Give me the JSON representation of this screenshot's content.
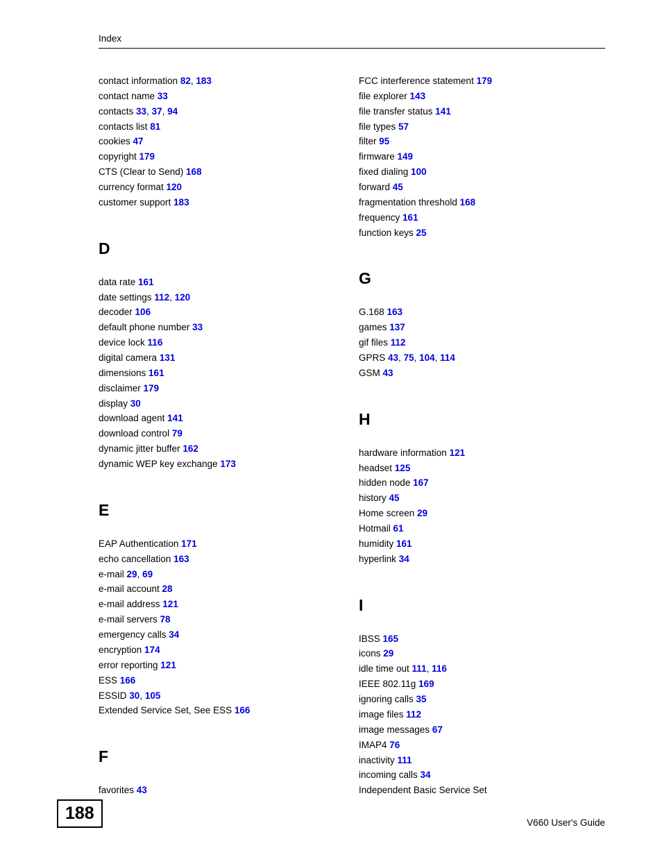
{
  "header": {
    "title": "Index"
  },
  "footer": {
    "page": "188",
    "guide": "V660 User's Guide"
  },
  "left": {
    "pre": [
      {
        "text": "contact information",
        "pages": [
          "82",
          "183"
        ]
      },
      {
        "text": "contact name",
        "pages": [
          "33"
        ]
      },
      {
        "text": "contacts",
        "pages": [
          "33",
          "37",
          "94"
        ]
      },
      {
        "text": "contacts list",
        "pages": [
          "81"
        ]
      },
      {
        "text": "cookies",
        "pages": [
          "47"
        ]
      },
      {
        "text": "copyright",
        "pages": [
          "179"
        ]
      },
      {
        "text": "CTS (Clear to Send)",
        "pages": [
          "168"
        ]
      },
      {
        "text": "currency format",
        "pages": [
          "120"
        ]
      },
      {
        "text": "customer support",
        "pages": [
          "183"
        ]
      }
    ],
    "sections": [
      {
        "letter": "D",
        "entries": [
          {
            "text": "data rate",
            "pages": [
              "161"
            ]
          },
          {
            "text": "date settings",
            "pages": [
              "112",
              "120"
            ]
          },
          {
            "text": "decoder",
            "pages": [
              "106"
            ]
          },
          {
            "text": "default phone number",
            "pages": [
              "33"
            ]
          },
          {
            "text": "device lock",
            "pages": [
              "116"
            ]
          },
          {
            "text": "digital camera",
            "pages": [
              "131"
            ]
          },
          {
            "text": "dimensions",
            "pages": [
              "161"
            ]
          },
          {
            "text": "disclaimer",
            "pages": [
              "179"
            ]
          },
          {
            "text": "display",
            "pages": [
              "30"
            ]
          },
          {
            "text": "download agent",
            "pages": [
              "141"
            ]
          },
          {
            "text": "download control",
            "pages": [
              "79"
            ]
          },
          {
            "text": "dynamic jitter buffer",
            "pages": [
              "162"
            ]
          },
          {
            "text": "dynamic WEP key exchange",
            "pages": [
              "173"
            ]
          }
        ]
      },
      {
        "letter": "E",
        "entries": [
          {
            "text": "EAP Authentication",
            "pages": [
              "171"
            ]
          },
          {
            "text": "echo cancellation",
            "pages": [
              "163"
            ]
          },
          {
            "text": "e-mail",
            "pages": [
              "29",
              "69"
            ]
          },
          {
            "text": "e-mail account",
            "pages": [
              "28"
            ]
          },
          {
            "text": "e-mail address",
            "pages": [
              "121"
            ]
          },
          {
            "text": "e-mail servers",
            "pages": [
              "78"
            ]
          },
          {
            "text": "emergency calls",
            "pages": [
              "34"
            ]
          },
          {
            "text": "encryption",
            "pages": [
              "174"
            ]
          },
          {
            "text": "error reporting",
            "pages": [
              "121"
            ]
          },
          {
            "text": "ESS",
            "pages": [
              "166"
            ]
          },
          {
            "text": "ESSID",
            "pages": [
              "30",
              "105"
            ]
          },
          {
            "text": "Extended Service Set, See ESS",
            "pages": [
              "166"
            ]
          }
        ]
      },
      {
        "letter": "F",
        "entries": [
          {
            "text": "favorites",
            "pages": [
              "43"
            ]
          }
        ]
      }
    ]
  },
  "right": {
    "pre": [
      {
        "text": "FCC interference statement",
        "pages": [
          "179"
        ]
      },
      {
        "text": "file explorer",
        "pages": [
          "143"
        ]
      },
      {
        "text": "file transfer status",
        "pages": [
          "141"
        ]
      },
      {
        "text": "file types",
        "pages": [
          "57"
        ]
      },
      {
        "text": "filter",
        "pages": [
          "95"
        ]
      },
      {
        "text": "firmware",
        "pages": [
          "149"
        ]
      },
      {
        "text": "fixed dialing",
        "pages": [
          "100"
        ]
      },
      {
        "text": "forward",
        "pages": [
          "45"
        ]
      },
      {
        "text": "fragmentation threshold",
        "pages": [
          "168"
        ]
      },
      {
        "text": "frequency",
        "pages": [
          "161"
        ]
      },
      {
        "text": "function keys",
        "pages": [
          "25"
        ]
      }
    ],
    "sections": [
      {
        "letter": "G",
        "entries": [
          {
            "text": "G.168",
            "pages": [
              "163"
            ]
          },
          {
            "text": "games",
            "pages": [
              "137"
            ]
          },
          {
            "text": "gif files",
            "pages": [
              "112"
            ]
          },
          {
            "text": "GPRS",
            "pages": [
              "43",
              "75",
              "104",
              "114"
            ]
          },
          {
            "text": "GSM",
            "pages": [
              "43"
            ]
          }
        ]
      },
      {
        "letter": "H",
        "entries": [
          {
            "text": "hardware information",
            "pages": [
              "121"
            ]
          },
          {
            "text": "headset",
            "pages": [
              "125"
            ]
          },
          {
            "text": "hidden node",
            "pages": [
              "167"
            ]
          },
          {
            "text": "history",
            "pages": [
              "45"
            ]
          },
          {
            "text": "Home screen",
            "pages": [
              "29"
            ]
          },
          {
            "text": "Hotmail",
            "pages": [
              "61"
            ]
          },
          {
            "text": "humidity",
            "pages": [
              "161"
            ]
          },
          {
            "text": "hyperlink",
            "pages": [
              "34"
            ]
          }
        ]
      },
      {
        "letter": "I",
        "entries": [
          {
            "text": "IBSS",
            "pages": [
              "165"
            ]
          },
          {
            "text": "icons",
            "pages": [
              "29"
            ]
          },
          {
            "text": "idle time out",
            "pages": [
              "111",
              "116"
            ]
          },
          {
            "text": "IEEE 802.11g",
            "pages": [
              "169"
            ]
          },
          {
            "text": "ignoring calls",
            "pages": [
              "35"
            ]
          },
          {
            "text": "image files",
            "pages": [
              "112"
            ]
          },
          {
            "text": "image messages",
            "pages": [
              "67"
            ]
          },
          {
            "text": "IMAP4",
            "pages": [
              "76"
            ]
          },
          {
            "text": "inactivity",
            "pages": [
              "111"
            ]
          },
          {
            "text": "incoming calls",
            "pages": [
              "34"
            ]
          },
          {
            "text": "Independent Basic Service Set",
            "pages": []
          }
        ]
      }
    ]
  }
}
